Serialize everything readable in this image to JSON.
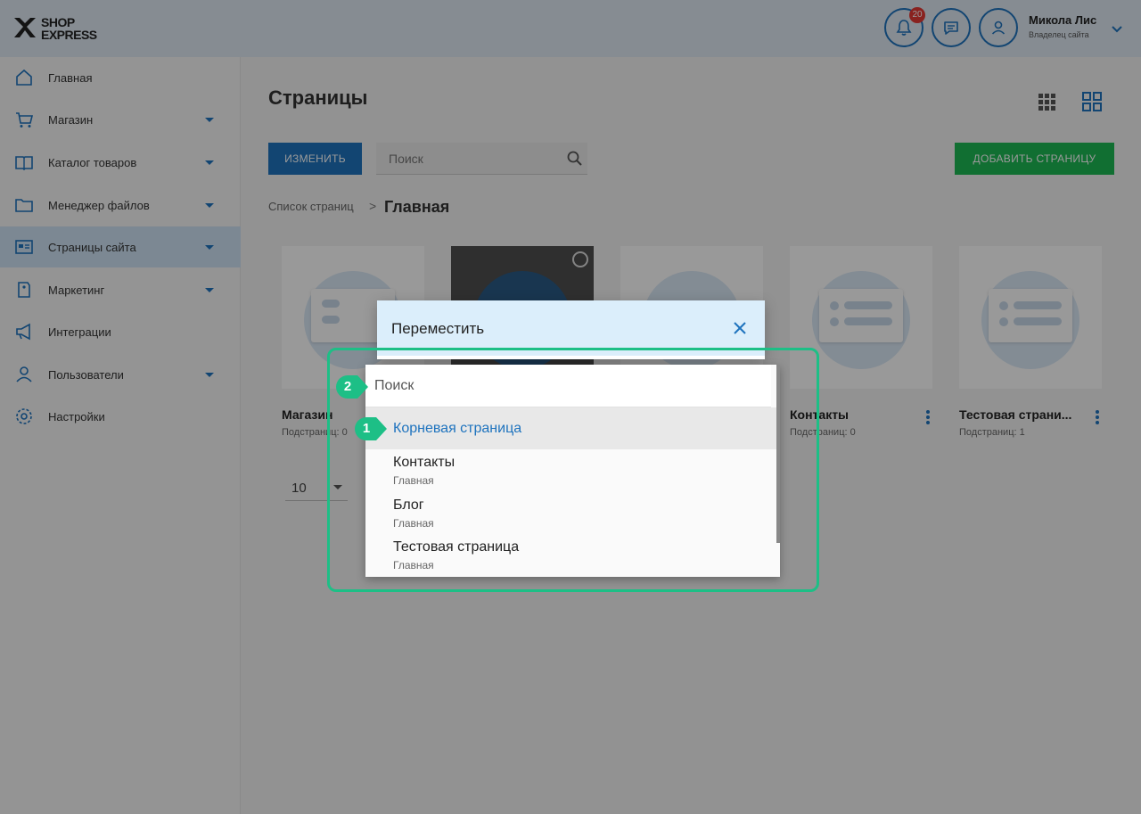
{
  "header": {
    "logo_text": "SHOP EXPRESS",
    "notifications_count": "20",
    "user_name": "Микола Лис",
    "user_role": "Владелец сайта"
  },
  "sidebar": {
    "items": [
      {
        "label": "Главная",
        "icon": "home-icon",
        "has_submenu": false
      },
      {
        "label": "Магазин",
        "icon": "cart-icon",
        "has_submenu": true
      },
      {
        "label": "Каталог товаров",
        "icon": "book-icon",
        "has_submenu": true
      },
      {
        "label": "Менеджер файлов",
        "icon": "folder-icon",
        "has_submenu": true
      },
      {
        "label": "Страницы сайта",
        "icon": "pages-icon",
        "has_submenu": true,
        "active": true
      },
      {
        "label": "Маркетинг",
        "icon": "tag-icon",
        "has_submenu": true
      },
      {
        "label": "Интеграции",
        "icon": "megaphone-icon",
        "has_submenu": false
      },
      {
        "label": "Пользователи",
        "icon": "users-icon",
        "has_submenu": true
      },
      {
        "label": "Настройки",
        "icon": "gear-icon",
        "has_submenu": false
      }
    ]
  },
  "main": {
    "title": "Страницы",
    "edit_button": "Изменить",
    "search_placeholder": "Поиск",
    "add_button": "Добавить страницу",
    "breadcrumb": {
      "parent": "Список страниц",
      "separator": ">",
      "current": "Главная"
    },
    "cards": [
      {
        "name": "Магазин",
        "sub": "Подстраниц: 0"
      },
      {
        "name": "",
        "sub": ""
      },
      {
        "name": "",
        "sub": ""
      },
      {
        "name": "Контакты",
        "sub": "Подстраниц: 0"
      },
      {
        "name": "Тестовая страни...",
        "sub": "Подстраниц: 1"
      }
    ],
    "per_page": "10"
  },
  "modal": {
    "title": "Переместить",
    "search_placeholder": "Поиск",
    "options": [
      {
        "title": "Корневая страница",
        "sub": ""
      },
      {
        "title": "Контакты",
        "sub": "Главная"
      },
      {
        "title": "Блог",
        "sub": "Главная"
      },
      {
        "title": "Тестовая страница",
        "sub": "Главная"
      }
    ]
  },
  "annotations": {
    "marker_1": "1",
    "marker_2": "2"
  },
  "colors": {
    "accent": "#1e73be",
    "add_button": "#1db954",
    "annotation": "#1dbf86",
    "modal_header": "#dbeefb"
  }
}
